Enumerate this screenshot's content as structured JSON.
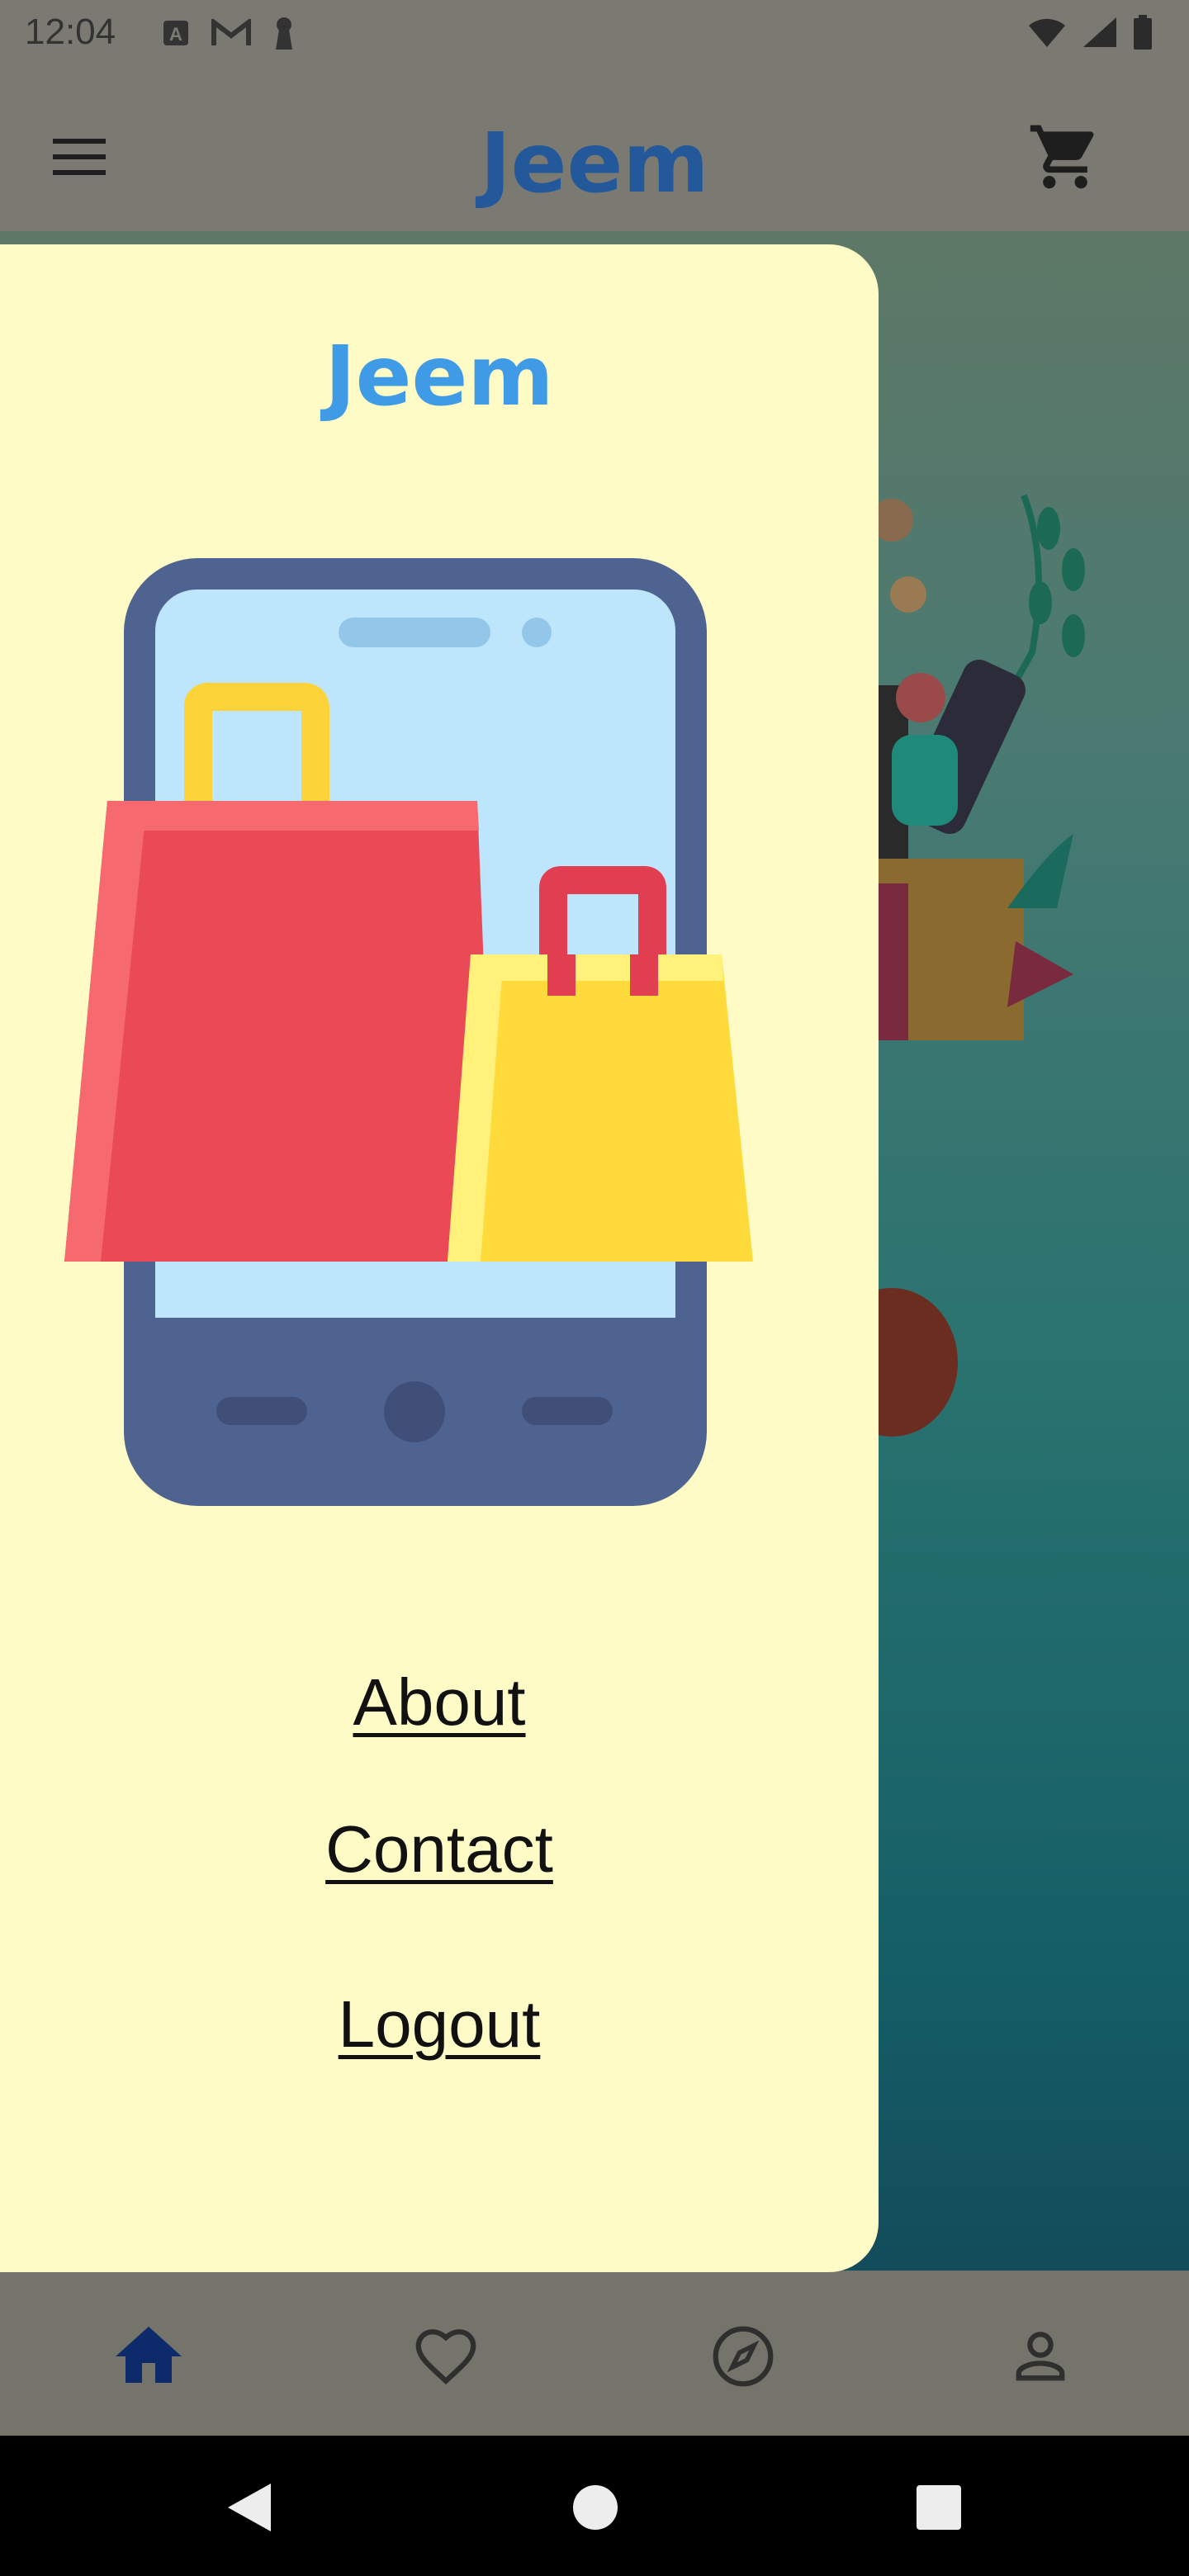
{
  "status_bar": {
    "time": "12:04",
    "left_icons": [
      "a-notification-icon",
      "gmail-icon",
      "keyhole-icon"
    ],
    "right_icons": [
      "wifi-icon",
      "signal-icon",
      "battery-icon"
    ]
  },
  "app_bar": {
    "brand": "Jeem",
    "menu_icon": "hamburger-menu-icon",
    "cart_icon": "shopping-cart-icon"
  },
  "drawer": {
    "brand": "Jeem",
    "links": [
      "About",
      "Contact",
      "Logout"
    ]
  },
  "bottom_nav": {
    "items": [
      {
        "icon": "home-icon",
        "active": true
      },
      {
        "icon": "heart-icon",
        "active": false
      },
      {
        "icon": "compass-icon",
        "active": false
      },
      {
        "icon": "profile-icon",
        "active": false
      }
    ]
  },
  "system_nav": [
    "back-icon",
    "home-circle-icon",
    "recents-icon"
  ],
  "colors": {
    "brand_blue_dim": "#23599a",
    "brand_blue": "#3f9be6",
    "drawer_bg": "#fffbc7",
    "active_nav": "#0d2a6b"
  }
}
